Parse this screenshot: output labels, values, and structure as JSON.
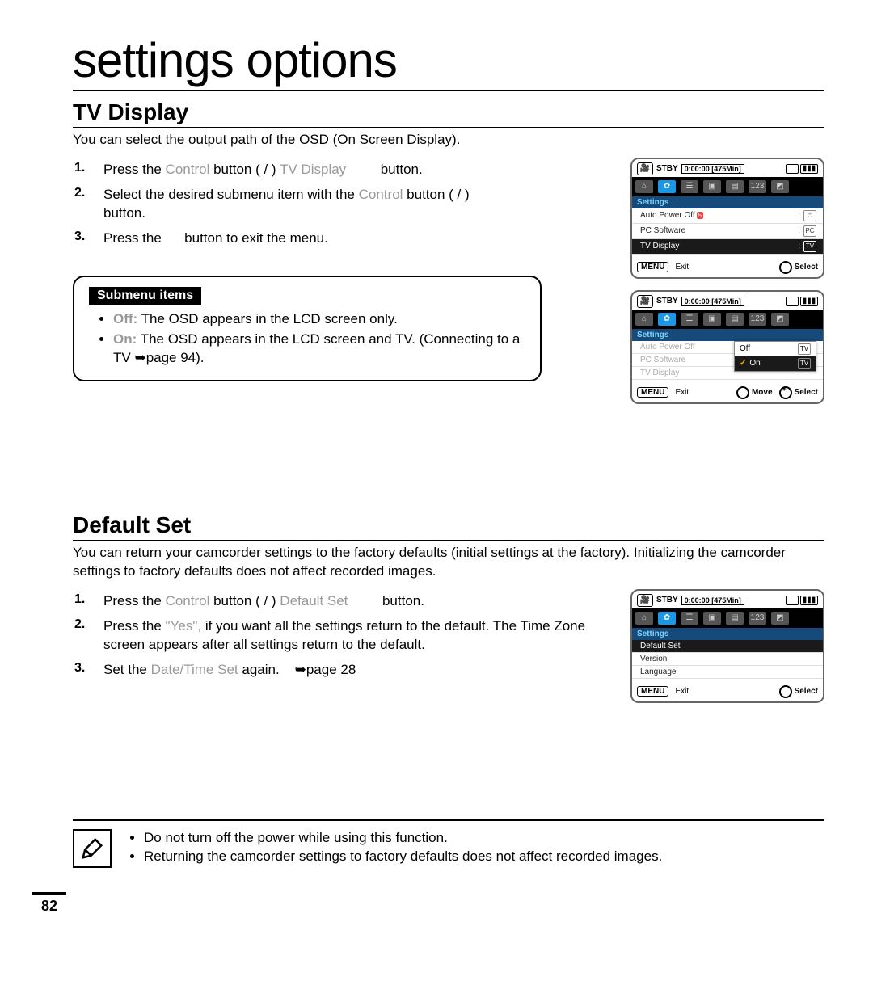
{
  "page_title": "settings options",
  "tv_display": {
    "heading": "TV Display",
    "desc": "You can select the output path of the OSD (On Screen Display).",
    "steps": [
      {
        "pre": "Press the ",
        "f1": "Control",
        "mid1": " button (",
        "mid2": " / ",
        "mid3": ") ",
        "f2": "TV Display",
        "post": " button."
      },
      {
        "pre": "Select the desired submenu item with the ",
        "f1": "Control",
        "mid1": " button (",
        "mid2": " / ",
        "mid3": ") ",
        "post2": "button."
      },
      {
        "pre": "Press the ",
        "mid": " button to exit the menu."
      }
    ],
    "submenu_label": "Submenu items",
    "submenu": [
      {
        "term": "Off:",
        "text": " The OSD appears in the LCD screen only."
      },
      {
        "term": "On:",
        "text": " The OSD appears in the LCD screen and TV. (Connecting to a TV ➥page 94)."
      }
    ]
  },
  "default_set": {
    "heading": "Default Set",
    "desc": "You can return your camcorder settings to the factory defaults (initial settings at the factory). Initializing the camcorder settings to factory defaults does not affect recorded images.",
    "steps": [
      {
        "pre": "Press the ",
        "f1": "Control",
        "mid1": " button (",
        "mid2": " / ",
        "mid3": ") ",
        "f2": "Default Set",
        "post": " button."
      },
      {
        "pre": "Press the ",
        "f1": "\"Yes\",",
        "post": " if you want all the settings return to the default. The Time Zone screen appears after all settings return to the default."
      },
      {
        "pre": "Set the ",
        "f1": "Date/Time Set",
        "mid": " again.",
        "ref": "➥page 28"
      }
    ]
  },
  "screens": {
    "status": "STBY",
    "time": "0:00:00",
    "remain": "[475Min]",
    "tabs_label": "Settings",
    "menu_a": [
      {
        "label": "Auto Power Off",
        "badge": "5"
      },
      {
        "label": "PC Software"
      },
      {
        "label": "TV Display"
      }
    ],
    "popup": {
      "off": "Off",
      "on": "On"
    },
    "menu_b": [
      {
        "label": "Default Set"
      },
      {
        "label": "Version"
      },
      {
        "label": "Language"
      }
    ],
    "bottom": {
      "menu": "MENU",
      "exit": "Exit",
      "select": "Select",
      "move": "Move"
    }
  },
  "notes": [
    "Do not turn off the power while using this function.",
    "Returning the camcorder settings to factory defaults does not affect recorded images."
  ],
  "page_number": "82"
}
